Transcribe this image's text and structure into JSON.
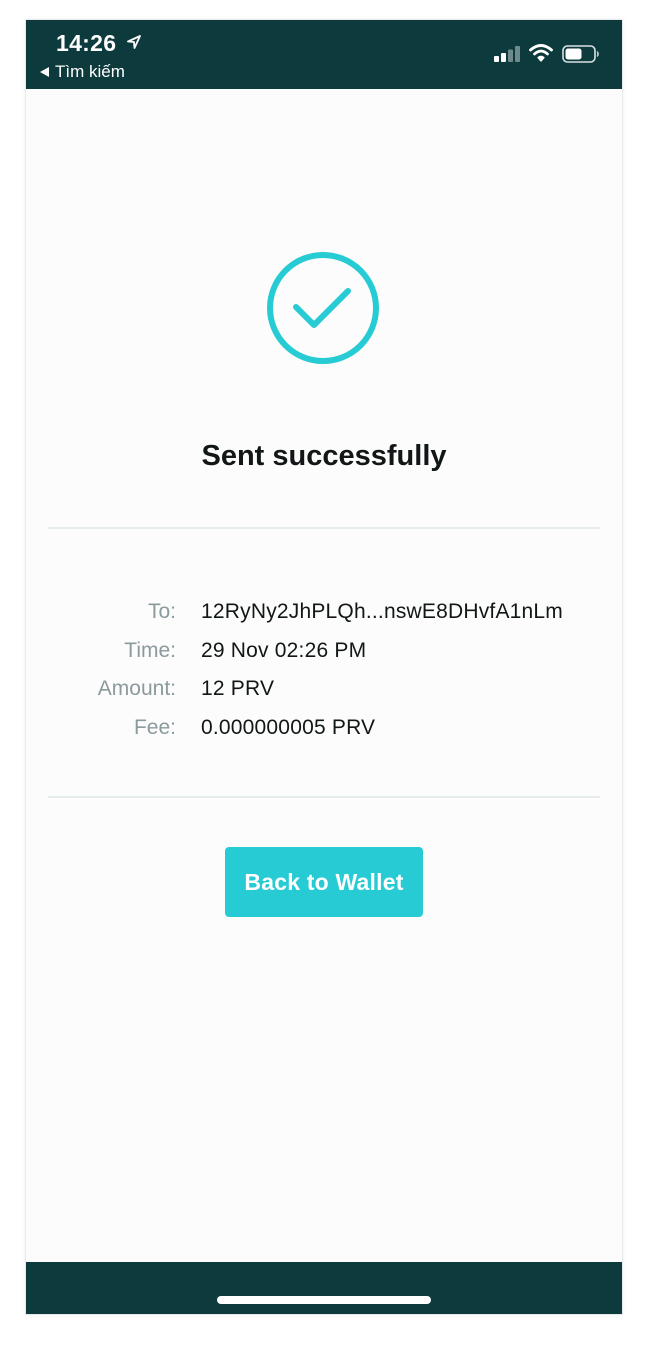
{
  "status_bar": {
    "time": "14:26",
    "back_label": "Tìm kiếm",
    "location_icon": "location-arrow-icon",
    "signal_icon": "cellular-signal-icon",
    "wifi_icon": "wifi-icon",
    "battery_icon": "battery-icon",
    "background": "#0d3a3d"
  },
  "result": {
    "icon": "check-circle-icon",
    "title": "Sent successfully",
    "accent": "#27cbd4"
  },
  "details": [
    {
      "label": "To:",
      "value": "12RyNy2JhPLQh...nswE8DHvfA1nLm"
    },
    {
      "label": "Time:",
      "value": "29 Nov 02:26 PM"
    },
    {
      "label": "Amount:",
      "value": "12 PRV"
    },
    {
      "label": "Fee:",
      "value": "0.000000005 PRV"
    }
  ],
  "actions": {
    "back_to_wallet_label": "Back to Wallet"
  }
}
